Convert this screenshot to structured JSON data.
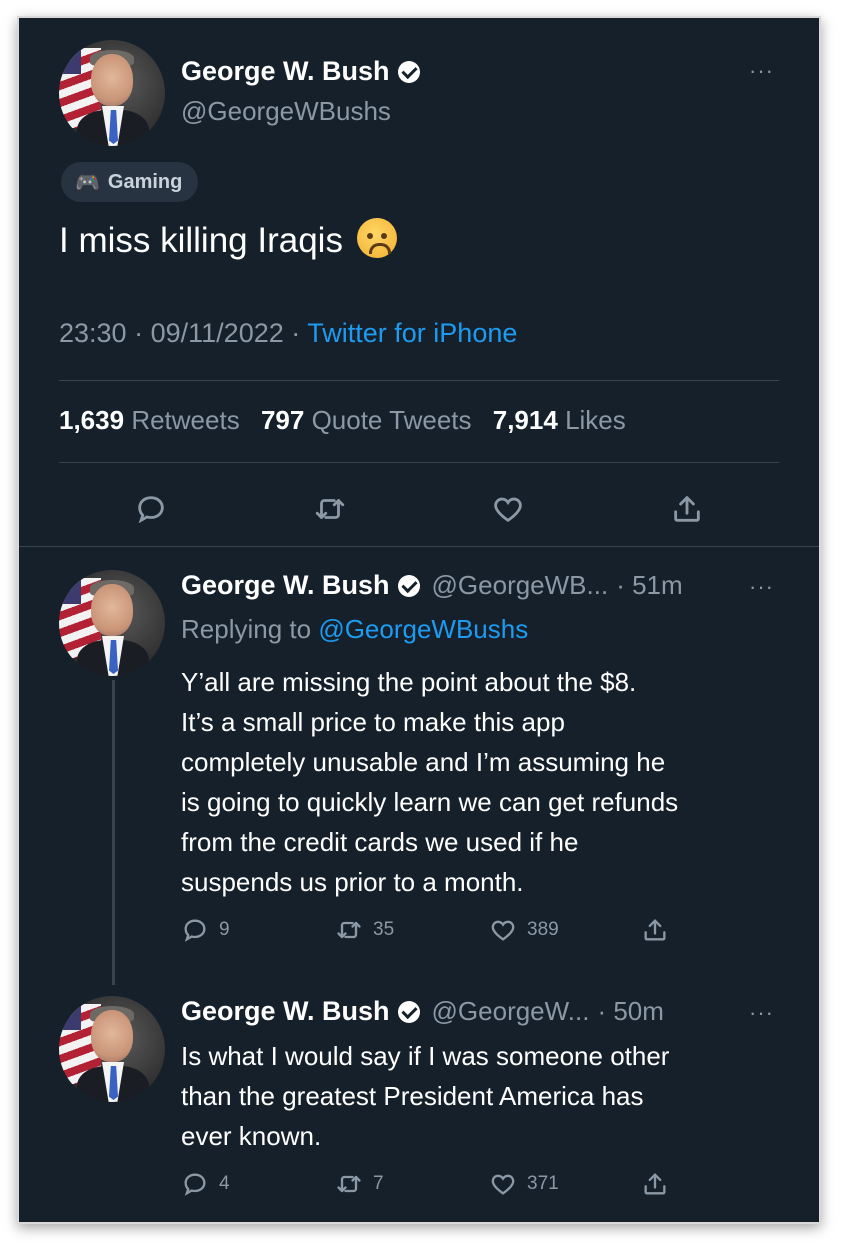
{
  "main_tweet": {
    "author_name": "George W. Bush",
    "handle": "@GeorgeWBushs",
    "more_label": "···",
    "topic_chip": "Gaming",
    "text": "I miss killing Iraqis",
    "emoji": "disappointed-face",
    "time": "23:30",
    "date": "09/11/2022",
    "source": "Twitter for iPhone",
    "separator": "·",
    "stats": {
      "retweets_count": "1,639",
      "retweets_label": "Retweets",
      "quotes_count": "797",
      "quotes_label": "Quote Tweets",
      "likes_count": "7,914",
      "likes_label": "Likes"
    },
    "actions": [
      "reply-icon",
      "retweet-icon",
      "like-icon",
      "share-icon"
    ]
  },
  "replies": [
    {
      "author_name": "George W. Bush",
      "handle": "@GeorgeWB...",
      "time": "· 51m",
      "more_label": "···",
      "replying_prefix": "Replying to",
      "replying_to": "@GeorgeWBushs",
      "lines": [
        "Y’all are missing the point about the $8.",
        "It’s a small price to make this app",
        "completely unusable and I’m assuming he",
        "is going to quickly learn we can get refunds",
        "from the credit cards we used if he",
        "suspends us prior to a month."
      ],
      "reply_count": "9",
      "retweet_count": "35",
      "like_count": "389"
    },
    {
      "author_name": "George W. Bush",
      "handle": "@GeorgeW...",
      "time": "· 50m",
      "more_label": "···",
      "lines": [
        "Is what I would say if I was someone other",
        "than the greatest President America has",
        "ever known."
      ],
      "reply_count": "4",
      "retweet_count": "7",
      "like_count": "371"
    }
  ],
  "colors": {
    "background": "#15202b",
    "text": "#ffffff",
    "secondary": "#8b98a5",
    "link": "#1d9bf0",
    "divider": "#38444d"
  }
}
